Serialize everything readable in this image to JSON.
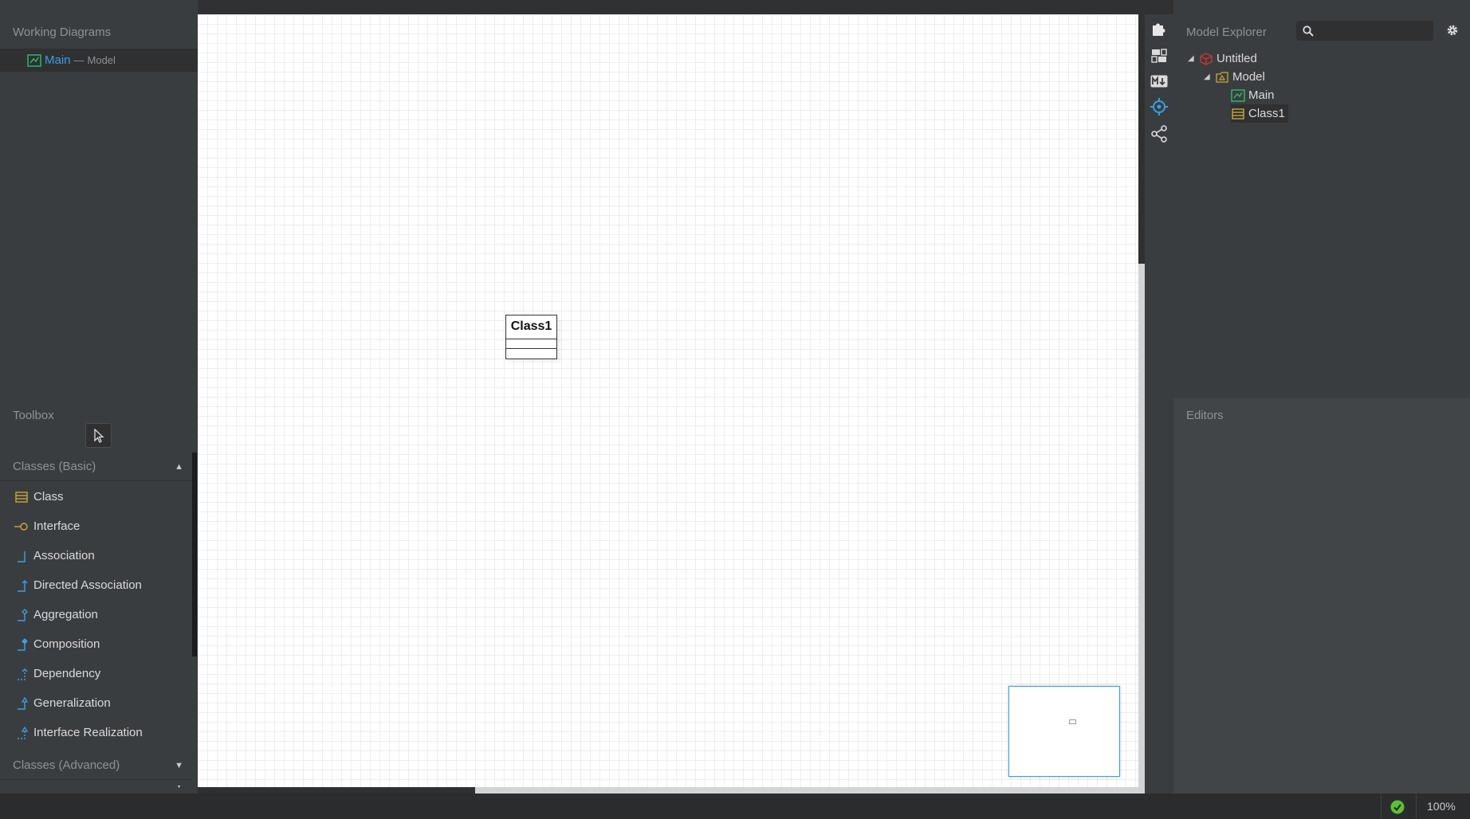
{
  "working_diagrams": {
    "title": "Working Diagrams",
    "items": [
      {
        "name": "Main",
        "separator": "—",
        "owner": "Model"
      }
    ]
  },
  "toolbox": {
    "title": "Toolbox",
    "sections": [
      {
        "label": "Classes (Basic)",
        "expanded": true
      },
      {
        "label": "Classes (Advanced)",
        "expanded": false
      }
    ],
    "items": [
      {
        "label": "Class",
        "icon": "class-icon"
      },
      {
        "label": "Interface",
        "icon": "interface-icon"
      },
      {
        "label": "Association",
        "icon": "association-icon"
      },
      {
        "label": "Directed Association",
        "icon": "directed-association-icon"
      },
      {
        "label": "Aggregation",
        "icon": "aggregation-icon"
      },
      {
        "label": "Composition",
        "icon": "composition-icon"
      },
      {
        "label": "Dependency",
        "icon": "dependency-icon"
      },
      {
        "label": "Generalization",
        "icon": "generalization-icon"
      },
      {
        "label": "Interface Realization",
        "icon": "interface-realization-icon"
      }
    ]
  },
  "diagram": {
    "class_name": "Class1"
  },
  "model_explorer": {
    "title": "Model Explorer",
    "search_placeholder": "",
    "tree": [
      {
        "label": "Untitled",
        "icon": "project-icon"
      },
      {
        "label": "Model",
        "icon": "model-icon"
      },
      {
        "label": "Main",
        "icon": "diagram-icon"
      },
      {
        "label": "Class1",
        "icon": "class-icon"
      }
    ]
  },
  "editors": {
    "title": "Editors"
  },
  "status": {
    "zoom": "100%"
  },
  "colors": {
    "accent": "#3a9fe8",
    "class_icon": "#c8a93a",
    "diagram_icon": "#2fb36f",
    "project_icon": "#c0392b",
    "ok": "#5fbf3a"
  }
}
